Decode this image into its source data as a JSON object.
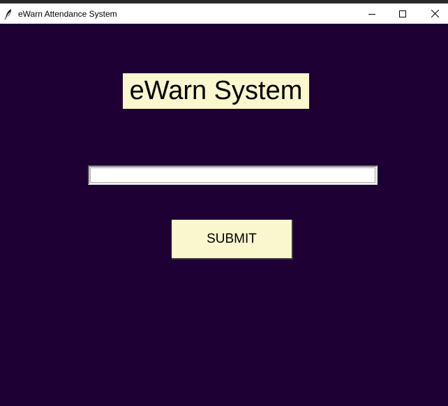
{
  "window": {
    "title": "eWarn Attendance System",
    "icon": "feather-icon"
  },
  "controls": {
    "minimize_icon": "minimize-icon",
    "maximize_icon": "maximize-icon",
    "close_icon": "close-icon"
  },
  "main": {
    "heading": "eWarn System",
    "input_value": "",
    "submit_label": "SUBMIT"
  },
  "colors": {
    "background": "#1e0035",
    "accent": "#faf6cd",
    "titlebar": "#ffffff"
  }
}
